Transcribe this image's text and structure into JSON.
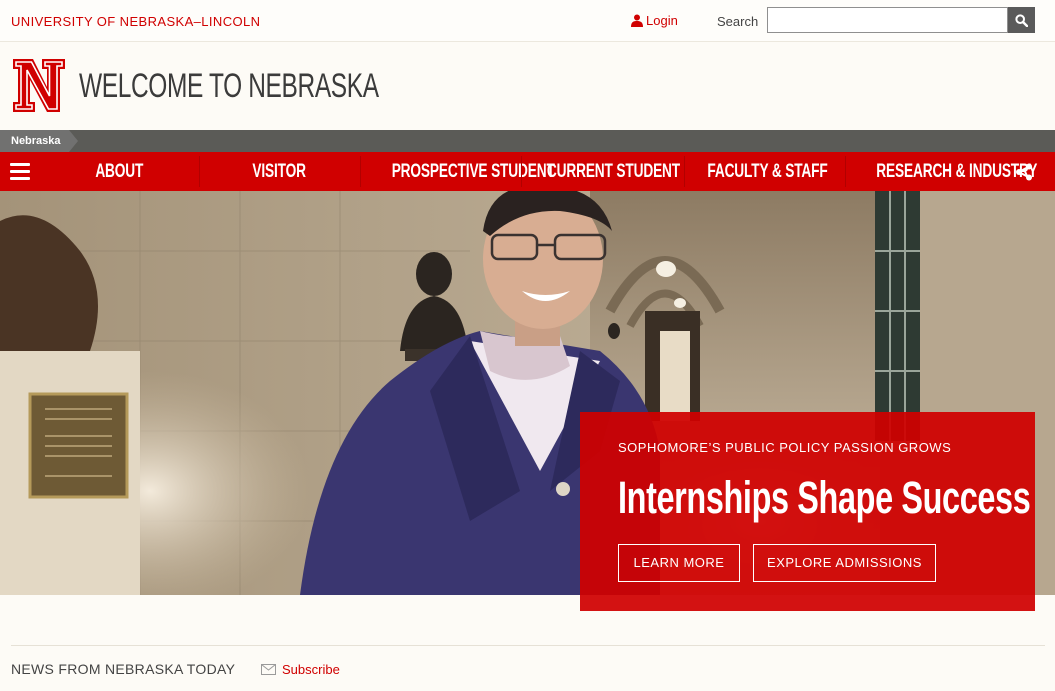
{
  "topbar": {
    "university": "UNIVERSITY OF NEBRASKA–LINCOLN",
    "login": "Login",
    "search_label": "Search",
    "search_value": ""
  },
  "header": {
    "title": "WELCOME TO NEBRASKA",
    "logo_icon": "nebraska-n-logo"
  },
  "breadcrumb": {
    "items": [
      "Nebraska"
    ]
  },
  "nav": {
    "items": [
      "ABOUT",
      "VISITOR",
      "PROSPECTIVE STUDENT",
      "CURRENT STUDENT",
      "FACULTY & STAFF",
      "RESEARCH & INDUSTRY"
    ],
    "menu_icon": "hamburger-icon",
    "share_icon": "share-icon"
  },
  "hero": {
    "kicker": "SOPHOMORE’S PUBLIC POLICY PASSION GROWS",
    "title": "Internships Shape Success",
    "buttons": [
      "LEARN MORE",
      "EXPLORE ADMISSIONS"
    ]
  },
  "news": {
    "label": "NEWS FROM NEBRASKA TODAY",
    "subscribe": "Subscribe"
  },
  "colors": {
    "brand_red": "#d00000",
    "breadcrumb_gray": "#5b5b57",
    "background": "#fdfbf6"
  }
}
